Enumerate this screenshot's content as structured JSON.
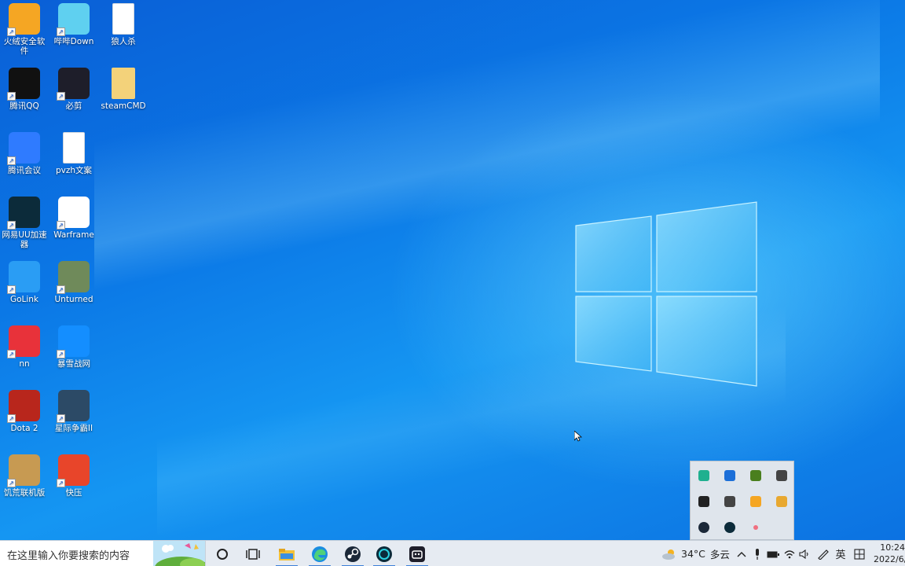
{
  "desktop": {
    "icons": [
      {
        "label": "火绒安全软件",
        "icon": "shield-fire-icon",
        "color": "#f5a623"
      },
      {
        "label": "哔哔Down",
        "icon": "bilibili-down-icon",
        "color": "#5fd0f0"
      },
      {
        "label": "狼人杀",
        "icon": "document-icon",
        "color": "#ffffff"
      },
      {
        "label": "腾讯QQ",
        "icon": "qq-penguin-icon",
        "color": "#111111"
      },
      {
        "label": "必剪",
        "icon": "bijian-robot-icon",
        "color": "#1e1e2a"
      },
      {
        "label": "steamCMD",
        "icon": "folder-icon",
        "color": "#f3d27a"
      },
      {
        "label": "腾讯会议",
        "icon": "tencent-meeting-icon",
        "color": "#2f7bff"
      },
      {
        "label": "pvzh文案",
        "icon": "document-icon",
        "color": "#ffffff"
      },
      {
        "label": "网易UU加速器",
        "icon": "uu-accelerator-icon",
        "color": "#0c2b3a"
      },
      {
        "label": "Warframe",
        "icon": "warframe-icon",
        "color": "#ffffff"
      },
      {
        "label": "GoLink",
        "icon": "golink-icon",
        "color": "#2a9df4"
      },
      {
        "label": "Unturned",
        "icon": "unturned-icon",
        "color": "#6f8a5a"
      },
      {
        "label": "nn",
        "icon": "nn-accelerator-icon",
        "color": "#e8323a"
      },
      {
        "label": "暴雪战网",
        "icon": "battlenet-icon",
        "color": "#148eff"
      },
      {
        "label": "Dota 2",
        "icon": "dota2-icon",
        "color": "#b8261c"
      },
      {
        "label": "星际争霸II",
        "icon": "starcraft2-icon",
        "color": "#2c4a66"
      },
      {
        "label": "饥荒联机版",
        "icon": "dont-starve-icon",
        "color": "#c79a52"
      },
      {
        "label": "快压",
        "icon": "kuaiya-archive-icon",
        "color": "#e8452a"
      }
    ]
  },
  "tray_overflow": {
    "items": [
      {
        "icon": "wechat-keyboard-icon",
        "color": "#1fb08f"
      },
      {
        "icon": "bluetooth-icon",
        "color": "#1c6fd8"
      },
      {
        "icon": "nvidia-icon",
        "color": "#4a7f1e"
      },
      {
        "icon": "media-tray-icon",
        "color": "#444444"
      },
      {
        "icon": "security-shield-icon",
        "color": "#222222"
      },
      {
        "icon": "onedrive-offline-icon",
        "color": "#444444"
      },
      {
        "icon": "huorong-tray-icon",
        "color": "#f5a623"
      },
      {
        "icon": "explorer-tray-icon",
        "color": "#e8a830"
      },
      {
        "icon": "steam-tray-icon",
        "color": "#1b2838"
      },
      {
        "icon": "uu-tray-icon",
        "color": "#0c2b3a"
      },
      {
        "icon": "record-dot-icon",
        "color": "#f07080"
      }
    ]
  },
  "taskbar": {
    "search_placeholder": "在这里输入你要搜索的内容",
    "apps": [
      {
        "icon": "cortana-icon"
      },
      {
        "icon": "task-view-icon"
      },
      {
        "icon": "file-explorer-icon"
      },
      {
        "icon": "edge-icon"
      },
      {
        "icon": "steam-icon"
      },
      {
        "icon": "uu-accelerator-icon"
      },
      {
        "icon": "bijian-icon"
      }
    ],
    "weather": {
      "temp": "34°C",
      "condition": "多云"
    },
    "ime_label": "英",
    "clock_time": "10:24",
    "clock_date": "2022/6/"
  },
  "colors": {
    "accent": "#3c7fd8",
    "taskbar_bg": "#e6ebf2"
  }
}
